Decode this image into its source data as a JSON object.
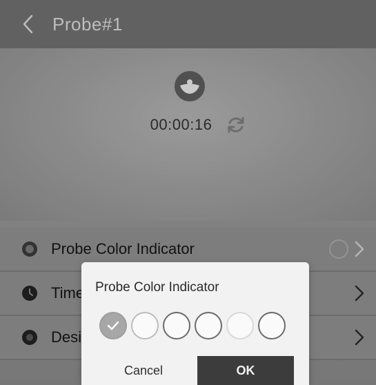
{
  "header": {
    "title": "Probe#1",
    "back_icon": "chevron-left-icon"
  },
  "hero": {
    "probe_icon": "probe-icon",
    "timer": "00:00:16",
    "refresh_icon": "refresh-icon"
  },
  "settings": {
    "items": [
      {
        "label": "Probe Color Indicator",
        "icon": "probe-color-icon"
      },
      {
        "label": "Time",
        "icon": "timer-icon"
      },
      {
        "label": "Desi",
        "icon": "doneness-icon"
      }
    ]
  },
  "dialog": {
    "title": "Probe Color Indicator",
    "colors": [
      {
        "name": "gray",
        "selected": true,
        "color": "#a7a7a7"
      },
      {
        "name": "white-1",
        "selected": false,
        "color": "#fafafa"
      },
      {
        "name": "white-2",
        "selected": false,
        "color": "#fafafa"
      },
      {
        "name": "white-3",
        "selected": false,
        "color": "#fafafa"
      },
      {
        "name": "white-4",
        "selected": false,
        "color": "#fafafa"
      },
      {
        "name": "white-5",
        "selected": false,
        "color": "#fafafa"
      }
    ],
    "cancel_label": "Cancel",
    "ok_label": "OK"
  },
  "colors": {
    "appbar": "#6f6f6f",
    "ok_button": "#3c3c3c",
    "dialog_bg": "#f2f2f2"
  }
}
